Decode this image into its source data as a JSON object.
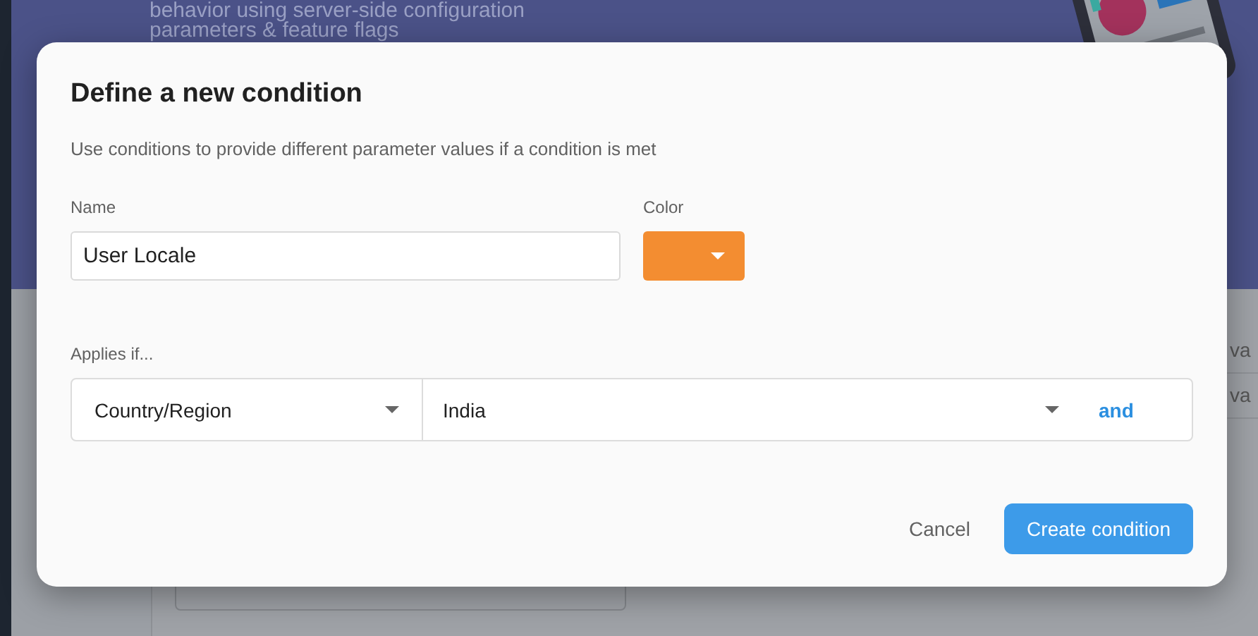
{
  "background": {
    "banner_lines": [
      "behavior using server-side configuration",
      "parameters & feature flags"
    ],
    "table_fragments": [
      "va",
      "va"
    ]
  },
  "dialog": {
    "title": "Define a new condition",
    "description": "Use conditions to provide different parameter values if a condition is met",
    "name_field": {
      "label": "Name",
      "value": "User Locale"
    },
    "color_field": {
      "label": "Color",
      "color": "#f38d31"
    },
    "applies_label": "Applies if...",
    "rule": {
      "attribute": "Country/Region",
      "value": "India",
      "add_link": "and"
    },
    "buttons": [
      {
        "label": "Cancel",
        "kind": "text"
      },
      {
        "label": "Create condition",
        "kind": "primary"
      }
    ]
  }
}
